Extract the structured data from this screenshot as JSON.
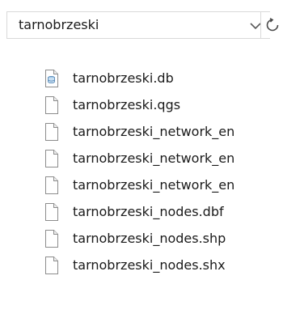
{
  "address_bar": {
    "path": "tarnobrzeski",
    "dropdown_icon": "chevron-down-icon",
    "refresh_icon": "refresh-icon"
  },
  "files": [
    {
      "name": "tarnobrzeski.db",
      "icon": "database-file-icon"
    },
    {
      "name": "tarnobrzeski.qgs",
      "icon": "file-icon"
    },
    {
      "name": "tarnobrzeski_network_en",
      "icon": "file-icon"
    },
    {
      "name": "tarnobrzeski_network_en",
      "icon": "file-icon"
    },
    {
      "name": "tarnobrzeski_network_en",
      "icon": "file-icon"
    },
    {
      "name": "tarnobrzeski_nodes.dbf",
      "icon": "file-icon"
    },
    {
      "name": "tarnobrzeski_nodes.shp",
      "icon": "file-icon"
    },
    {
      "name": "tarnobrzeski_nodes.shx",
      "icon": "file-icon"
    }
  ]
}
